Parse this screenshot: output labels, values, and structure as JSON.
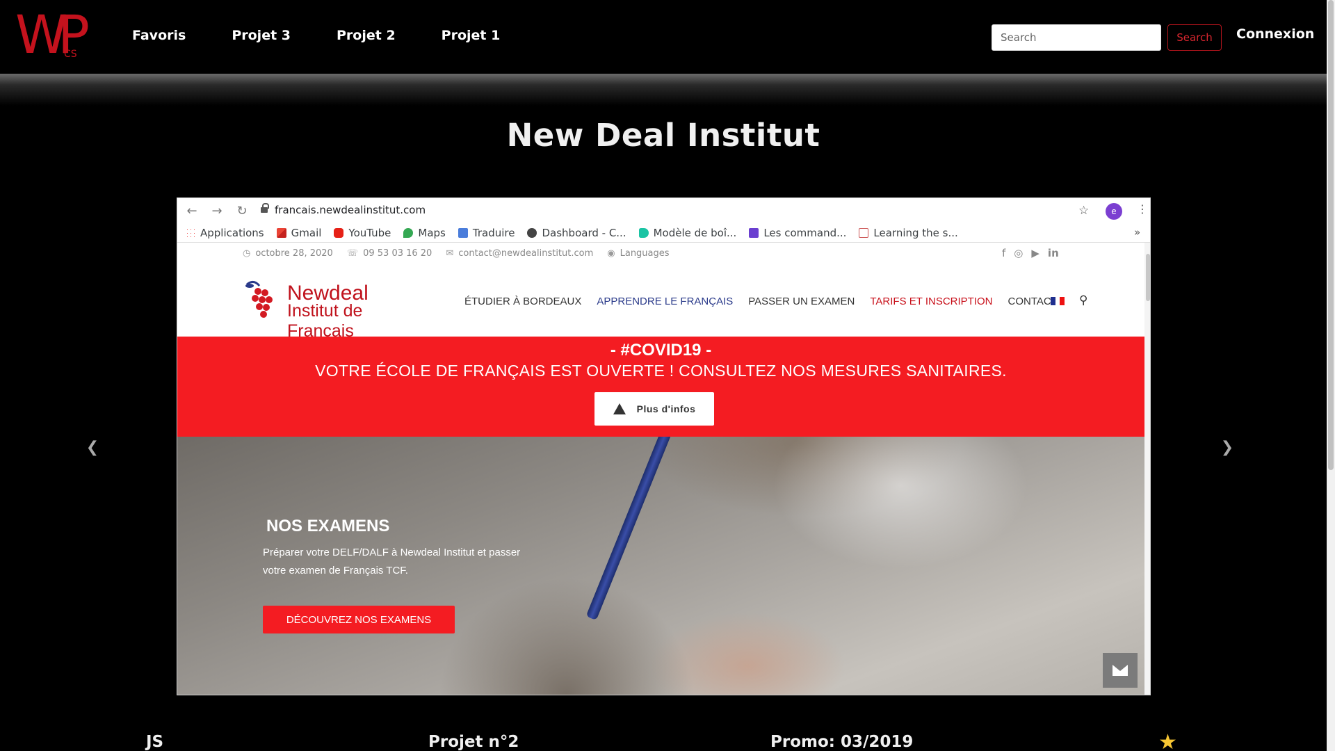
{
  "nav": {
    "logo_text": "WP",
    "logo_sub": "CS",
    "links": [
      "Favoris",
      "Projet 3",
      "Projet 2",
      "Projet 1"
    ],
    "search_placeholder": "Search",
    "search_button": "Search",
    "login": "Connexion"
  },
  "project": {
    "title": "New Deal Institut",
    "language": "JS",
    "number": "Projet n°2",
    "promo": "Promo: 03/2019"
  },
  "carousel": {
    "prev_icon": "chevron-left-icon",
    "next_icon": "chevron-right-icon"
  },
  "screenshot": {
    "url": "francais.newdealinstitut.com",
    "profile_initial": "e",
    "bookmarks": [
      "Applications",
      "Gmail",
      "YouTube",
      "Maps",
      "Traduire",
      "Dashboard - C...",
      "Modèle de boî...",
      "Les command...",
      "Learning the s..."
    ],
    "more": "»",
    "topinfo": {
      "date": "octobre 28, 2020",
      "phone": "09 53 03 16 20",
      "email": "contact@newdealinstitut.com",
      "languages": "Languages"
    },
    "logo_line1": "Newdeal",
    "logo_line2": "Institut de Français",
    "menu": [
      "ÉTUDIER À BORDEAUX",
      "APPRENDRE LE FRANÇAIS",
      "PASSER UN EXAMEN",
      "TARIFS ET INSCRIPTION",
      "CONTACT"
    ],
    "covid_title": "- #COVID19 -",
    "covid_text": "VOTRE ÉCOLE DE FRANÇAIS EST OUVERTE ! CONSULTEZ NOS MESURES SANITAIRES.",
    "covid_button": "Plus d'infos",
    "hero_title": "NOS EXAMENS",
    "hero_text": "Préparer votre DELF/DALF à Newdeal Institut et passer votre examen de Français TCF.",
    "hero_button": "DÉCOUVREZ NOS EXAMENS"
  },
  "colors": {
    "brand_red": "#c4121d",
    "covid_red": "#f41c22",
    "star": "#f7c633"
  }
}
